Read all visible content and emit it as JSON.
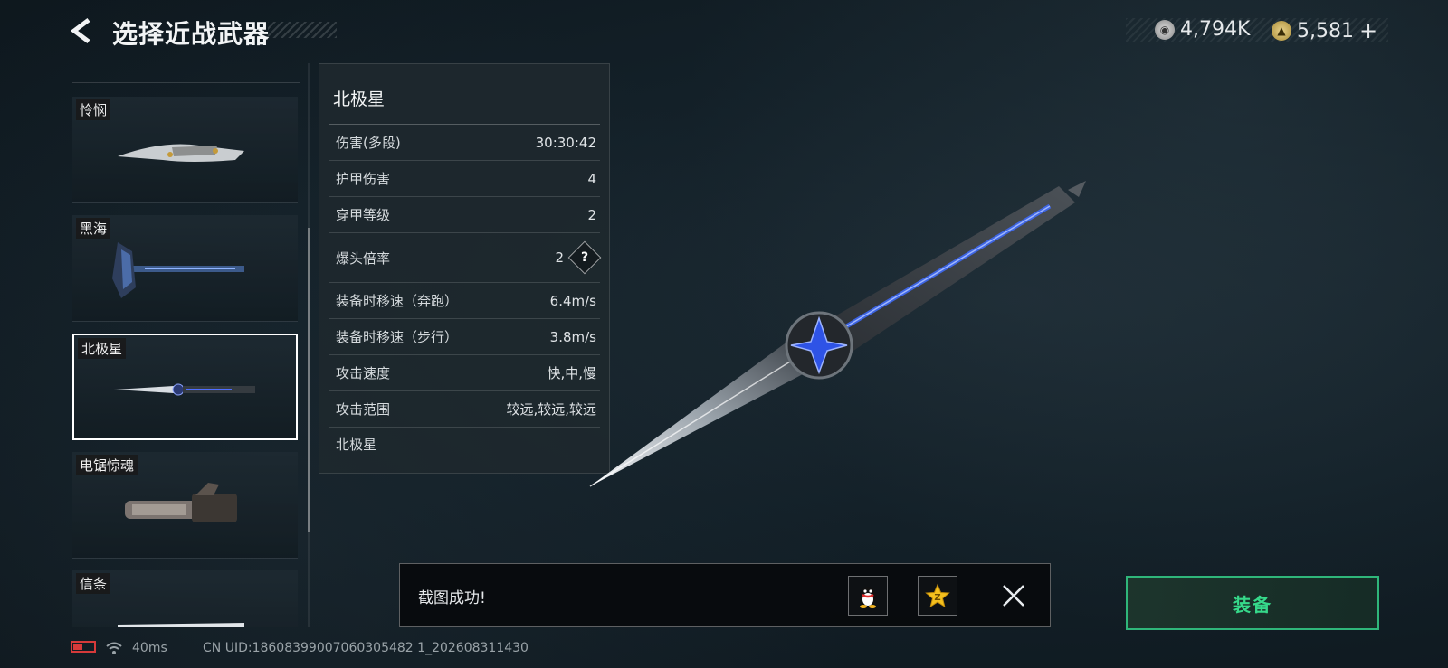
{
  "header": {
    "title": "选择近战武器"
  },
  "currency": {
    "silver": "4,794K",
    "gold": "5,581",
    "plus": "+"
  },
  "weapon_list": [
    {
      "name": "怜悯"
    },
    {
      "name": "黑海"
    },
    {
      "name": "北极星",
      "selected": true
    },
    {
      "name": "电锯惊魂"
    },
    {
      "name": "信条"
    }
  ],
  "panel": {
    "title": "北极星",
    "stats": [
      {
        "label": "伤害(多段)",
        "value": "30:30:42"
      },
      {
        "label": "护甲伤害",
        "value": "4"
      },
      {
        "label": "穿甲等级",
        "value": "2"
      },
      {
        "label": "爆头倍率",
        "value": "2",
        "help": "?"
      },
      {
        "label": "装备时移速（奔跑）",
        "value": "6.4m/s"
      },
      {
        "label": "装备时移速（步行）",
        "value": "3.8m/s"
      },
      {
        "label": "攻击速度",
        "value": "快,中,慢"
      },
      {
        "label": "攻击范围",
        "value": "较远,较远,较远"
      }
    ],
    "footer": "北极星"
  },
  "toast": {
    "message": "截图成功!"
  },
  "equip_label": "装备",
  "status_bar": {
    "ping": "40ms",
    "uid": "CN UID:18608399007060305482 1_202608311430"
  },
  "colors": {
    "accent_green": "#36d98a",
    "battery_red": "#d63a3a"
  }
}
